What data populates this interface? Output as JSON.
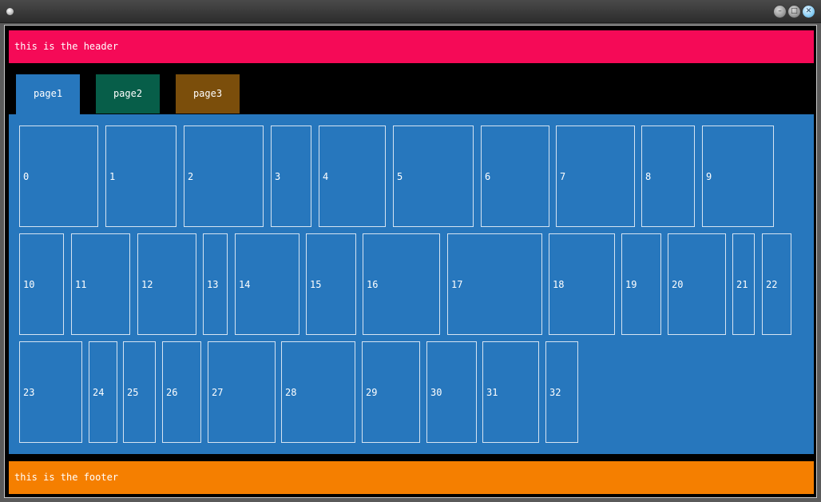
{
  "header": {
    "text": "this is the header"
  },
  "tabs": [
    {
      "label": "page1",
      "selected": true,
      "color": "#2777bd"
    },
    {
      "label": "page2",
      "selected": false,
      "color": "#075e49"
    },
    {
      "label": "page3",
      "selected": false,
      "color": "#7b4e0b"
    }
  ],
  "cards": [
    "0",
    "1",
    "2",
    "3",
    "4",
    "5",
    "6",
    "7",
    "8",
    "9",
    "10",
    "11",
    "12",
    "13",
    "14",
    "15",
    "16",
    "17",
    "18",
    "19",
    "20",
    "21",
    "22",
    "23",
    "24",
    "25",
    "26",
    "27",
    "28",
    "29",
    "30",
    "31",
    "32"
  ],
  "footer": {
    "text": "this is the footer"
  },
  "colors": {
    "header": "#f50a57",
    "content": "#2777bd",
    "footer": "#f57f00",
    "background": "#000000"
  }
}
